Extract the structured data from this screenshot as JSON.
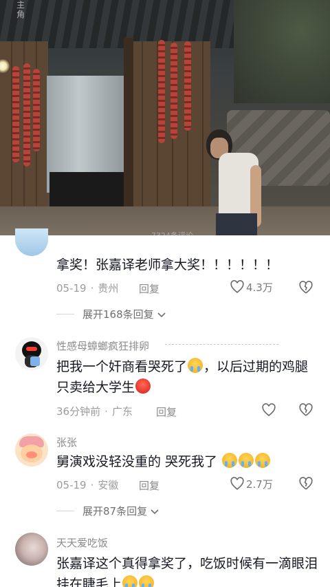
{
  "video": {
    "watermark_top": "主角",
    "watermark_bottom": "7324条评论"
  },
  "comments": [
    {
      "username": "",
      "text": "拿奖！张嘉译老师拿大奖！！！！！！",
      "date": "05-19",
      "location": "贵州",
      "reply_label": "回复",
      "likes": "4.3万",
      "expand_label": "展开168条回复"
    },
    {
      "username": "性感母蟑螂疯狂排卵",
      "text_part1": "把我一个奸商看哭死了",
      "text_part2": "，以后过期的鸡腿只卖给大学生",
      "date": "36分钟前",
      "location": "广东",
      "reply_label": "回复",
      "likes": ""
    },
    {
      "username": "张张",
      "text": "舅演戏没轻没重的 哭死我了",
      "date": "05-19",
      "location": "安徽",
      "reply_label": "回复",
      "likes": "2.7万",
      "expand_label": "展开87条回复"
    },
    {
      "username": "天天爱吃饭",
      "text": "张嘉译这个真得拿奖了，吃饭时候有一滴眼泪挂在睫毛上"
    }
  ],
  "colors": {
    "text_primary": "#161823",
    "text_secondary": "#9c9c9c"
  }
}
